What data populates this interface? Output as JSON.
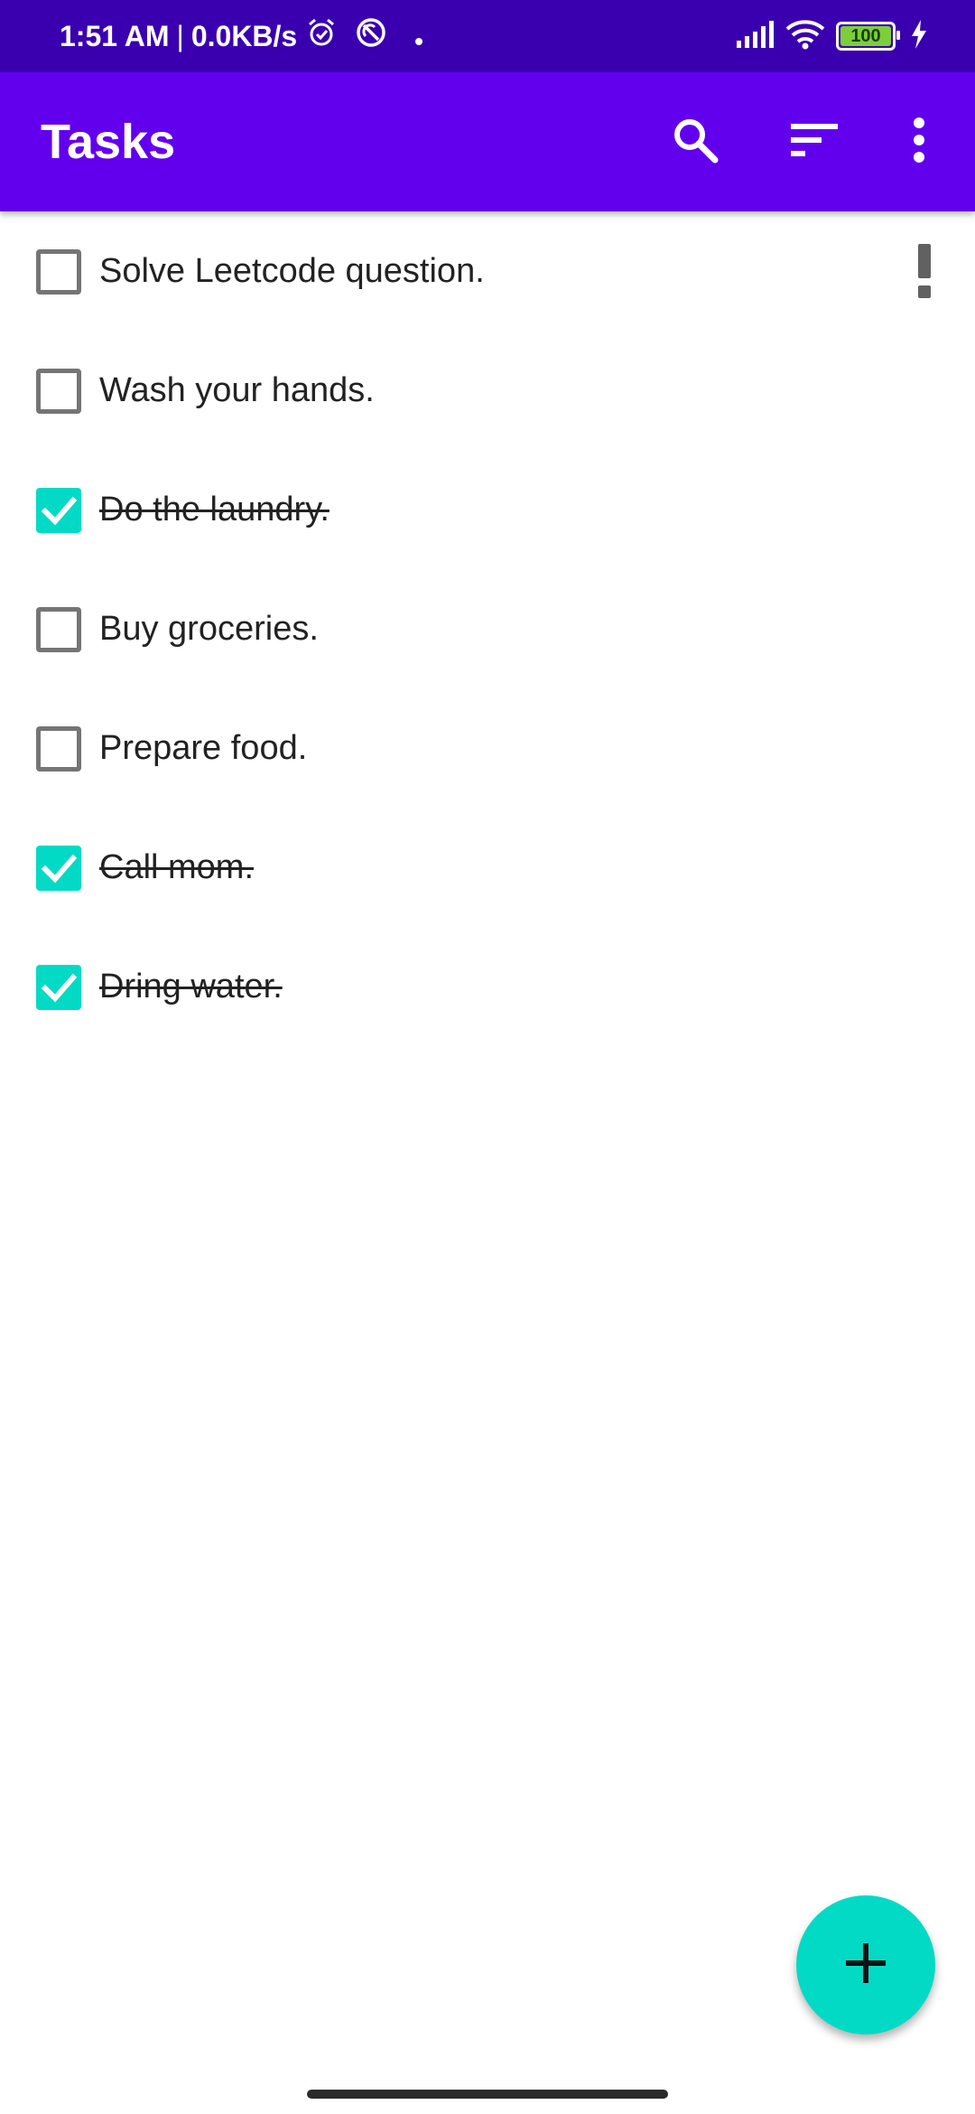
{
  "status_bar": {
    "time": "1:51 AM",
    "separator": "|",
    "network_speed": "0.0KB/s",
    "battery_level": "100",
    "icons": [
      "alarm-icon",
      "sync-off-icon",
      "dot-icon",
      "signal-icon",
      "wifi-icon",
      "battery-icon",
      "charging-icon"
    ]
  },
  "app_bar": {
    "title": "Tasks",
    "actions": [
      "search-icon",
      "sort-icon",
      "more-vert-icon"
    ]
  },
  "tasks": [
    {
      "label": "Solve Leetcode question.",
      "completed": false,
      "important": true
    },
    {
      "label": "Wash your hands.",
      "completed": false,
      "important": false
    },
    {
      "label": "Do the laundry.",
      "completed": true,
      "important": false
    },
    {
      "label": "Buy groceries.",
      "completed": false,
      "important": false
    },
    {
      "label": "Prepare food.",
      "completed": false,
      "important": false
    },
    {
      "label": "Call mom.",
      "completed": true,
      "important": false
    },
    {
      "label": "Dring water.",
      "completed": true,
      "important": false
    }
  ],
  "fab": {
    "icon": "plus-icon"
  },
  "colors": {
    "status_bar": "#3a00b0",
    "primary": "#6200ee",
    "accent": "#03dac5",
    "checkbox_unchecked": "#757575",
    "priority": "#616161"
  }
}
